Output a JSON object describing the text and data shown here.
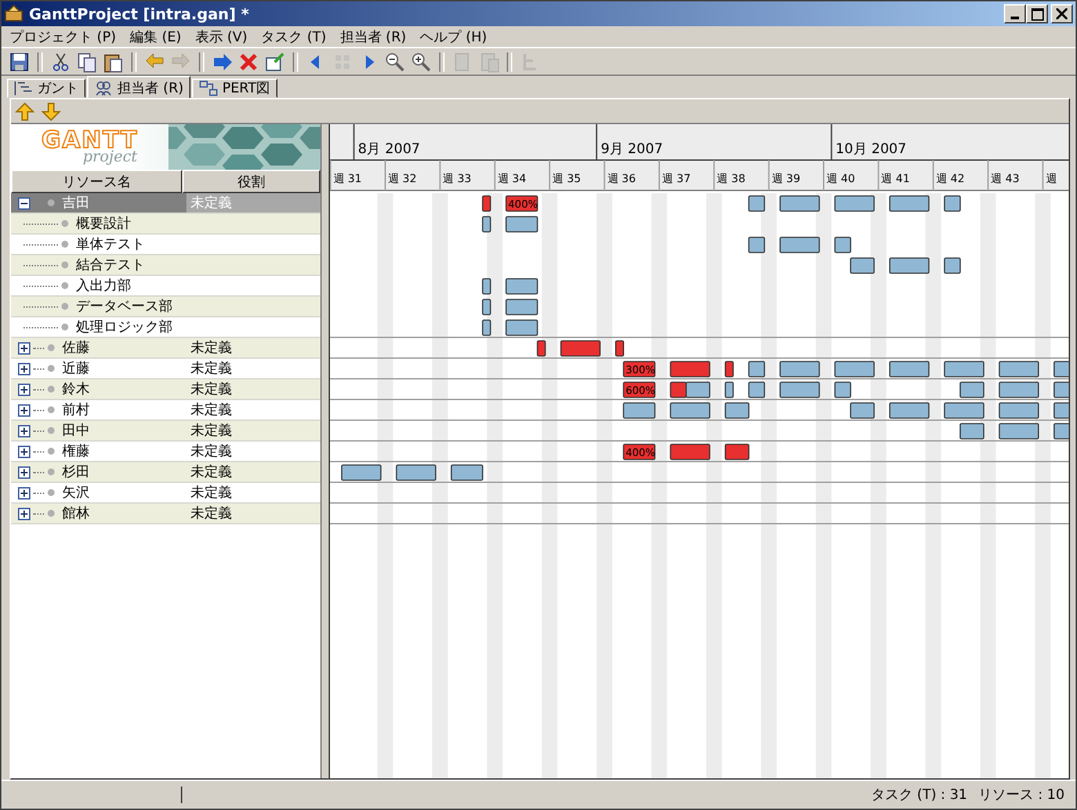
{
  "window": {
    "title": "GanttProject [intra.gan] *"
  },
  "menu": [
    "プロジェクト (P)",
    "編集 (E)",
    "表示 (V)",
    "タスク (T)",
    "担当者 (R)",
    "ヘルプ (H)"
  ],
  "toolbar": [
    {
      "kind": "save",
      "disabled": false
    },
    {
      "kind": "sep"
    },
    {
      "kind": "cut",
      "disabled": false
    },
    {
      "kind": "copy",
      "disabled": false
    },
    {
      "kind": "paste",
      "disabled": false
    },
    {
      "kind": "sep"
    },
    {
      "kind": "undo",
      "disabled": false
    },
    {
      "kind": "redo",
      "disabled": true
    },
    {
      "kind": "sep"
    },
    {
      "kind": "new",
      "disabled": false
    },
    {
      "kind": "delete",
      "disabled": false
    },
    {
      "kind": "properties",
      "disabled": false
    },
    {
      "kind": "sep"
    },
    {
      "kind": "prev",
      "disabled": false
    },
    {
      "kind": "grid",
      "disabled": true
    },
    {
      "kind": "next",
      "disabled": false
    },
    {
      "kind": "zoom-out",
      "disabled": false
    },
    {
      "kind": "zoom-in",
      "disabled": false
    },
    {
      "kind": "sep"
    },
    {
      "kind": "doc",
      "disabled": true
    },
    {
      "kind": "docs",
      "disabled": true
    },
    {
      "kind": "sep"
    },
    {
      "kind": "tree",
      "disabled": true
    }
  ],
  "tabs": [
    {
      "label": "ガント",
      "kind": "gantt",
      "selected": false
    },
    {
      "label": "担当者 (R)",
      "kind": "people",
      "selected": true
    },
    {
      "label": "PERT図",
      "kind": "pert",
      "selected": false
    }
  ],
  "resource_toolbar": [
    {
      "kind": "up"
    },
    {
      "kind": "down"
    }
  ],
  "logo": {
    "title": "GANTT",
    "subtitle": "project"
  },
  "resource_table": {
    "columns": [
      "リソース名",
      "役割"
    ],
    "rows": [
      {
        "name": "吉田",
        "role": "未定義",
        "selected": true,
        "expanded": true,
        "bars": [
          {
            "overload": true
          },
          {
            "overload": true,
            "label": "400%"
          },
          {
            "overload": false
          },
          {
            "overload": false
          },
          {
            "overload": false
          },
          {
            "overload": false
          },
          {
            "overload": false
          }
        ],
        "children": [
          {
            "name": "概要設計",
            "selected": false,
            "bars": [
              {
                "overload": false
              },
              {
                "overload": false
              }
            ]
          },
          {
            "name": "単体テスト",
            "selected": false,
            "bars": [
              {
                "overload": false
              },
              {
                "overload": false
              },
              {
                "overload": false
              }
            ]
          },
          {
            "name": "結合テスト",
            "selected": false,
            "bars": [
              {
                "overload": false
              },
              {
                "overload": false
              },
              {
                "overload": false
              }
            ]
          },
          {
            "name": "入出力部",
            "selected": false,
            "bars": [
              {
                "overload": false
              },
              {
                "overload": false
              }
            ]
          },
          {
            "name": "データベース部",
            "selected": false,
            "bars": [
              {
                "overload": false
              },
              {
                "overload": false
              }
            ]
          },
          {
            "name": "処理ロジック部",
            "selected": false,
            "bars": [
              {
                "overload": false
              },
              {
                "overload": false
              }
            ]
          }
        ]
      },
      {
        "name": "佐藤",
        "role": "未定義",
        "selected": false,
        "expanded": false,
        "bars": [
          {
            "overload": true
          },
          {
            "overload": true
          },
          {
            "overload": true
          }
        ]
      },
      {
        "name": "近藤",
        "role": "未定義",
        "selected": false,
        "expanded": false,
        "bars": [
          {
            "overload": true,
            "label": "300%"
          },
          {
            "overload": true
          },
          {
            "overload": true
          },
          {
            "overload": false
          },
          {
            "overload": false
          },
          {
            "overload": false
          },
          {
            "overload": false
          },
          {
            "overload": false
          },
          {
            "overload": false
          },
          {
            "overload": false
          }
        ]
      },
      {
        "name": "鈴木",
        "role": "未定義",
        "selected": false,
        "expanded": false,
        "bars": [
          {
            "overload": true,
            "label": "600%"
          },
          {
            "overload": true
          },
          {
            "overload": false
          },
          {
            "overload": false
          },
          {
            "overload": false
          },
          {
            "overload": false
          },
          {
            "overload": false
          },
          {
            "overload": false
          },
          {
            "overload": false
          },
          {
            "overload": false
          }
        ]
      },
      {
        "name": "前村",
        "role": "未定義",
        "selected": false,
        "expanded": false,
        "bars": [
          {
            "overload": false
          },
          {
            "overload": false
          },
          {
            "overload": false
          },
          {
            "overload": false
          },
          {
            "overload": false
          },
          {
            "overload": false
          },
          {
            "overload": false
          },
          {
            "overload": false
          }
        ]
      },
      {
        "name": "田中",
        "role": "未定義",
        "selected": false,
        "expanded": false,
        "bars": [
          {
            "overload": false
          },
          {
            "overload": false
          },
          {
            "overload": false
          }
        ]
      },
      {
        "name": "権藤",
        "role": "未定義",
        "selected": false,
        "expanded": false,
        "bars": [
          {
            "overload": true,
            "label": "400%"
          },
          {
            "overload": true
          },
          {
            "overload": true
          }
        ]
      },
      {
        "name": "杉田",
        "role": "未定義",
        "selected": false,
        "expanded": false,
        "bars": [
          {
            "overload": false
          },
          {
            "overload": false
          },
          {
            "overload": false
          }
        ]
      },
      {
        "name": "矢沢",
        "role": "未定義",
        "selected": false,
        "expanded": false
      },
      {
        "name": "館林",
        "role": "未定義",
        "selected": false,
        "expanded": false
      }
    ]
  },
  "timeline": {
    "months": [
      "8月 2007",
      "9月 2007",
      "10月 2007"
    ],
    "weeks": [
      "週 31",
      "週 32",
      "週 33",
      "週 34",
      "週 35",
      "週 36",
      "週 37",
      "週 38",
      "週 39",
      "週 40",
      "週 41",
      "週 42",
      "週 43",
      "週"
    ]
  },
  "status_bar": {
    "tasks": "タスク (T) : 31",
    "resources": "リソース : 10"
  }
}
